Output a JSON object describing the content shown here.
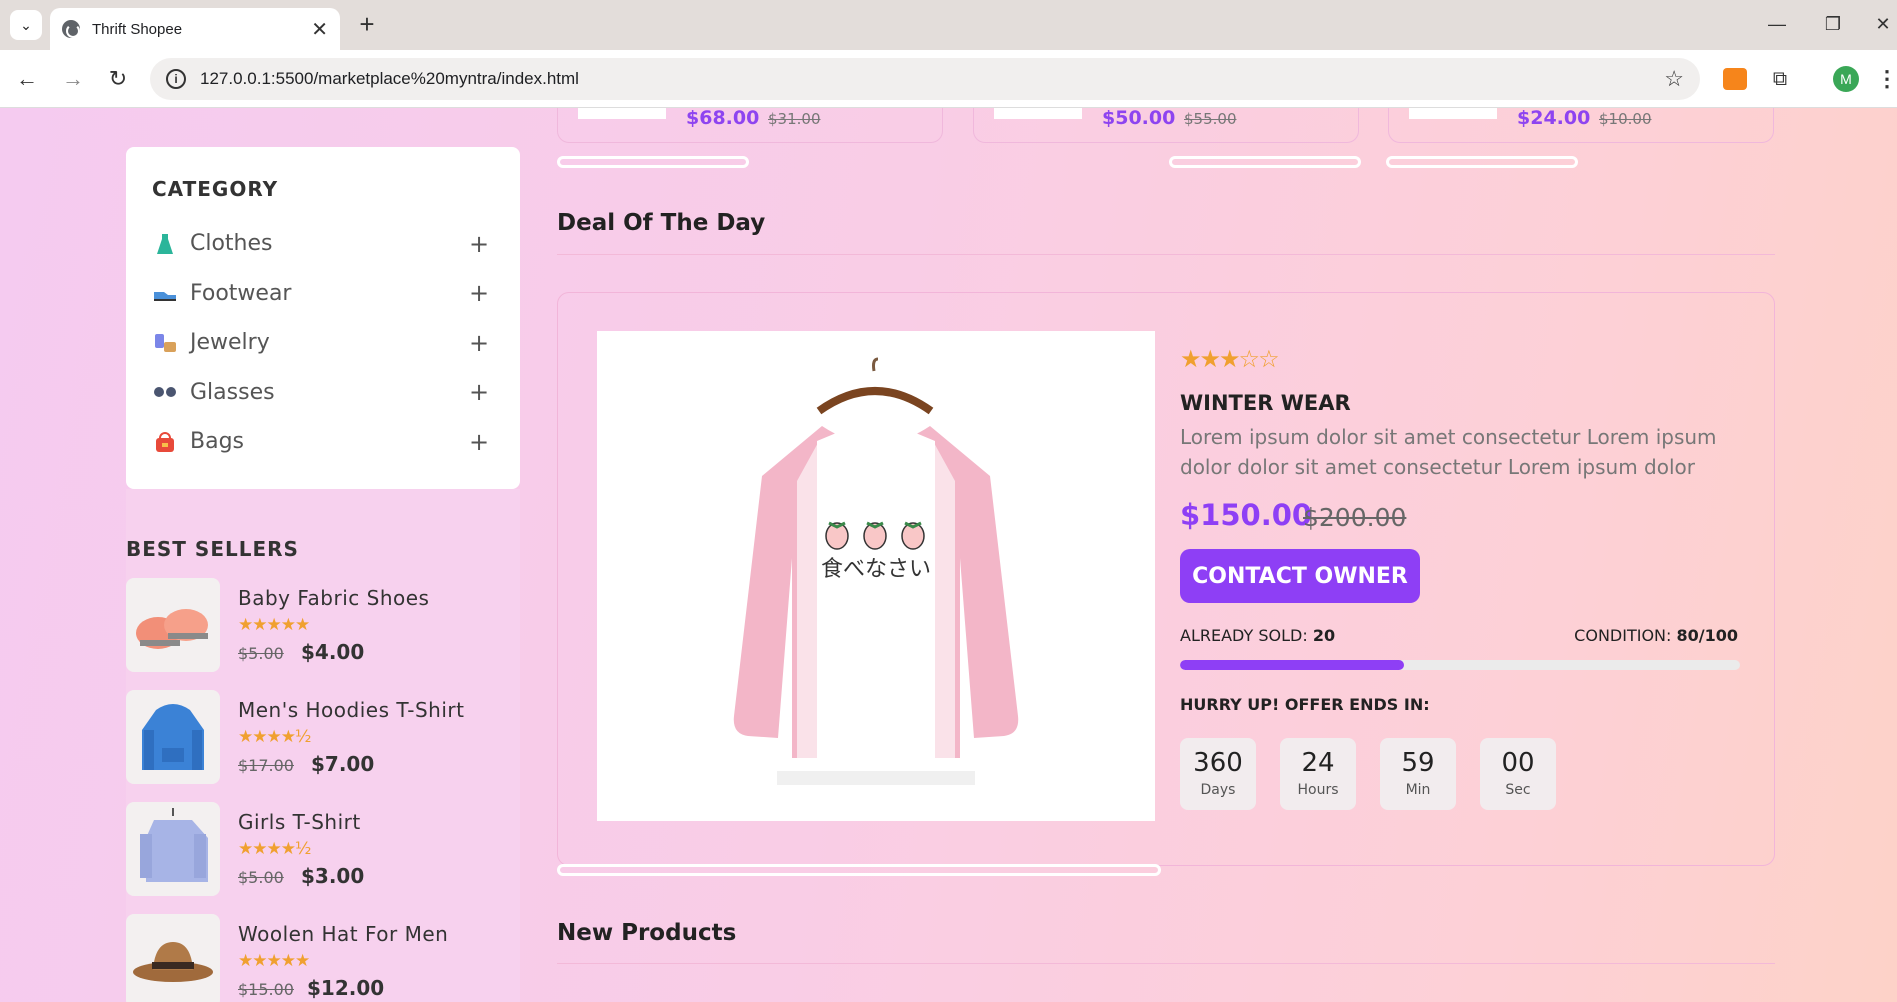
{
  "browser": {
    "tab_title": "Thrift Shopee",
    "url": "127.0.0.1:5500/marketplace%20myntra/index.html",
    "profile_initial": "M"
  },
  "top_cards": [
    {
      "price": "$68.00",
      "old_price": "$31.00"
    },
    {
      "price": "$50.00",
      "old_price": "$55.00"
    },
    {
      "price": "$24.00",
      "old_price": "$10.00"
    }
  ],
  "sidebar": {
    "category_title": "CATEGORY",
    "categories": [
      {
        "label": "Clothes",
        "icon": "dress-icon",
        "color": "#2bb59a"
      },
      {
        "label": "Footwear",
        "icon": "shoe-icon",
        "color": "#4a90d9"
      },
      {
        "label": "Jewelry",
        "icon": "jewelry-icon",
        "color": "#7b86e8"
      },
      {
        "label": "Glasses",
        "icon": "glasses-icon",
        "color": "#4a5570"
      },
      {
        "label": "Bags",
        "icon": "bag-icon",
        "color": "#e84a3a"
      }
    ],
    "expand_symbol": "+",
    "best_sellers_title": "BEST SELLERS",
    "best_sellers": [
      {
        "name": "Baby Fabric Shoes",
        "rating": 5,
        "stars": "★★★★★",
        "old_price": "$5.00",
        "price": "$4.00"
      },
      {
        "name": "Men's Hoodies T-Shirt",
        "rating": 4.5,
        "stars": "★★★★½",
        "old_price": "$17.00",
        "price": "$7.00"
      },
      {
        "name": "Girls T-Shirt",
        "rating": 4.5,
        "stars": "★★★★½",
        "old_price": "$5.00",
        "price": "$3.00"
      },
      {
        "name": "Woolen Hat For Men",
        "rating": 5,
        "stars": "★★★★★",
        "old_price": "$15.00",
        "price": "$12.00"
      }
    ]
  },
  "deal": {
    "section_title": "Deal Of The Day",
    "rating": 3,
    "stars_filled": "★★★",
    "stars_empty": "☆☆",
    "name": "WINTER WEAR",
    "description": "Lorem ipsum dolor sit amet consectetur Lorem ipsum dolor dolor sit amet consectetur Lorem ipsum dolor",
    "price": "$150.00",
    "old_price": "$200.00",
    "button_label": "CONTACT OWNER",
    "sold_label": "ALREADY SOLD:",
    "sold_value": "20",
    "condition_label": "CONDITION:",
    "condition_value": "80/100",
    "progress_fraction": 0.4,
    "hurry_text": "HURRY UP! OFFER ENDS IN:",
    "countdown": [
      {
        "value": "360",
        "unit": "Days"
      },
      {
        "value": "24",
        "unit": "Hours"
      },
      {
        "value": "59",
        "unit": "Min"
      },
      {
        "value": "00",
        "unit": "Sec"
      }
    ],
    "shirt_text": "食べなさい"
  },
  "new_products": {
    "section_title": "New Products"
  },
  "colors": {
    "accent": "#8e3ff5",
    "star": "#f0a030"
  }
}
